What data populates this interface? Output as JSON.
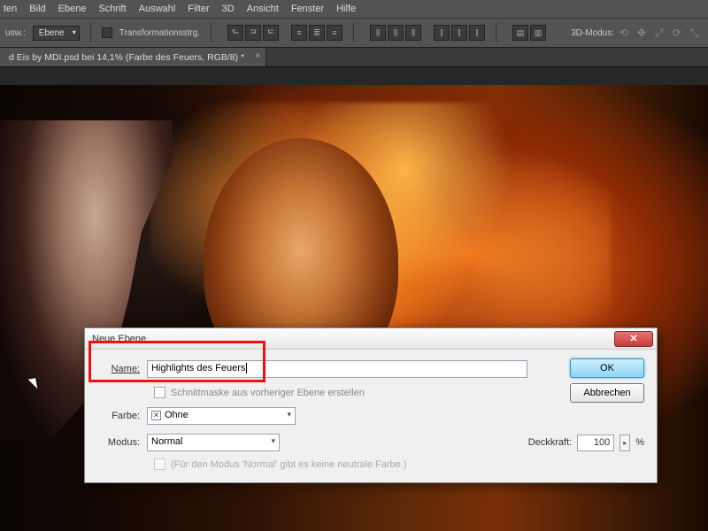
{
  "menubar": {
    "items": [
      "ten",
      "Bild",
      "Ebene",
      "Schrift",
      "Auswahl",
      "Filter",
      "3D",
      "Ansicht",
      "Fenster",
      "Hilfe"
    ]
  },
  "optionsbar": {
    "label_left": "usw.:",
    "dropdown": "Ebene",
    "transform_label": "Transformationsstrg.",
    "mode3d_label": "3D-Modus:"
  },
  "tab": {
    "title": "d Eis by MDI.psd bei 14,1% (Farbe des Feuers, RGB/8) *",
    "close": "×"
  },
  "dialog": {
    "title": "Neue Ebene",
    "close_icon": "✕",
    "name_label": "Name:",
    "name_value": "Highlights des Feuers",
    "clipmask_label": "Schnittmaske aus vorheriger Ebene erstellen",
    "color_label": "Farbe:",
    "color_value": "Ohne",
    "mode_label": "Modus:",
    "mode_value": "Normal",
    "opacity_label": "Deckkraft:",
    "opacity_value": "100",
    "opacity_pct": "%",
    "neutral_label": "(Für den Modus 'Normal' gibt es keine neutrale Farbe.)",
    "ok": "OK",
    "cancel": "Abbrechen"
  }
}
